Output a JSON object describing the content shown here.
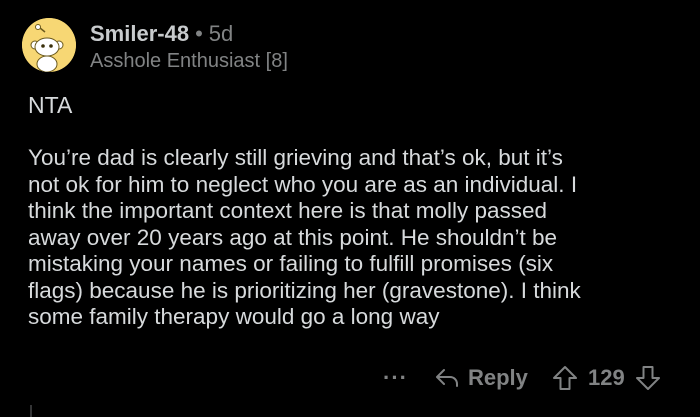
{
  "comment": {
    "author": "Smiler-48",
    "separator": "•",
    "age": "5d",
    "flair": "Asshole Enthusiast [8]",
    "verdict": "NTA",
    "body_lines": [
      "You’re dad is clearly still grieving and that’s ok, but it’s",
      "not ok for him to neglect who you are as an individual. I",
      "think the important context here is that molly passed",
      "away over 20 years ago at this point. He shouldn’t be",
      "mistaking your names or failing to fulfill promises (six",
      "flags) because he is prioritizing her (gravestone). I think",
      "some family therapy would go a long way"
    ]
  },
  "actions": {
    "more_label": "···",
    "reply_label": "Reply",
    "score": "129"
  },
  "icons": {
    "avatar": "snoo-avatar-icon",
    "reply": "reply-arrow-icon",
    "upvote": "upvote-arrow-icon",
    "downvote": "downvote-arrow-icon"
  },
  "colors": {
    "background": "#000000",
    "text": "#d7dadc",
    "meta": "#818384",
    "avatar_bg": "#f7d774"
  }
}
